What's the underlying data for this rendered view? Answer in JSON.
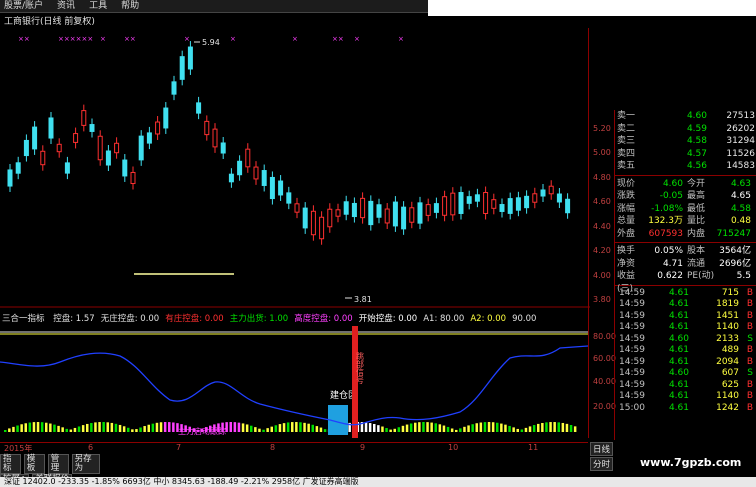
{
  "menu": [
    "股票/账户",
    "资讯",
    "工具",
    "帮助"
  ],
  "chart_title": "工商银行(日线 前复权)",
  "price_axis": [
    "5.20",
    "5.00",
    "4.80",
    "4.60",
    "4.40",
    "4.20",
    "4.00",
    "3.80"
  ],
  "annotations": {
    "high": "5.94",
    "low": "3.81"
  },
  "indicator": {
    "name": "三合一指标",
    "items": [
      {
        "label": "控盘: 1.57",
        "color": "#e0e0e0"
      },
      {
        "label": "无庄控盘: 0.00",
        "color": "#e0e0e0"
      },
      {
        "label": "有庄控盘: 0.00",
        "color": "#ff3030"
      },
      {
        "label": "主力出货: 1.00",
        "color": "#00e000"
      },
      {
        "label": "高度控盘: 0.00",
        "color": "#ff40ff"
      },
      {
        "label": "开始控盘: 0.00",
        "color": "#ffffff"
      },
      {
        "label": "A1: 80.00",
        "color": "#e0e0e0"
      },
      {
        "label": "A2: 0.00",
        "color": "#ffff40"
      },
      {
        "label": "90.00",
        "color": "#e0e0e0"
      }
    ]
  },
  "lower_axis": [
    "80.00",
    "60.00",
    "40.00",
    "20.00"
  ],
  "lower_labels": {
    "build": "建仓区",
    "sell": "跳部信号",
    "note": "主力启动跟踪"
  },
  "date_axis": [
    "2015年",
    "6",
    "7",
    "8",
    "9",
    "10",
    "11"
  ],
  "quotes": [
    {
      "label": "卖一",
      "price": "4.60",
      "vol": "27513"
    },
    {
      "label": "卖二",
      "price": "4.59",
      "vol": "26202"
    },
    {
      "label": "卖三",
      "price": "4.58",
      "vol": "31294"
    },
    {
      "label": "卖四",
      "price": "4.57",
      "vol": "11526"
    },
    {
      "label": "卖五",
      "price": "4.56",
      "vol": "14583"
    }
  ],
  "stats": [
    {
      "l1": "现价",
      "v1": "4.60",
      "l2": "今开",
      "v2": "4.63",
      "c1": "green",
      "c2": "green"
    },
    {
      "l1": "涨跌",
      "v1": "-0.05",
      "l2": "最高",
      "v2": "4.65",
      "c1": "green",
      "c2": "white"
    },
    {
      "l1": "涨幅",
      "v1": "-1.08%",
      "l2": "最低",
      "v2": "4.58",
      "c1": "green",
      "c2": "green"
    },
    {
      "l1": "总量",
      "v1": "132.3万",
      "l2": "量比",
      "v2": "0.48",
      "c1": "yellow",
      "c2": "yellow"
    },
    {
      "l1": "外盘",
      "v1": "607593",
      "l2": "内盘",
      "v2": "715247",
      "c1": "red",
      "c2": "green"
    }
  ],
  "stats2": [
    {
      "l1": "换手",
      "v1": "0.05%",
      "l2": "股本",
      "v2": "3564亿",
      "c1": "white",
      "c2": "white"
    },
    {
      "l1": "净资",
      "v1": "4.71",
      "l2": "流通",
      "v2": "2696亿",
      "c1": "white",
      "c2": "white"
    },
    {
      "l1": "收益(三)",
      "v1": "0.622",
      "l2": "PE(动)",
      "v2": "5.5",
      "c1": "white",
      "c2": "white"
    }
  ],
  "ticks": [
    {
      "time": "14:59",
      "price": "4.61",
      "vol": "715",
      "bs": "B"
    },
    {
      "time": "14:59",
      "price": "4.61",
      "vol": "1819",
      "bs": "B"
    },
    {
      "time": "14:59",
      "price": "4.61",
      "vol": "1451",
      "bs": "B"
    },
    {
      "time": "14:59",
      "price": "4.61",
      "vol": "1140",
      "bs": "B"
    },
    {
      "time": "14:59",
      "price": "4.60",
      "vol": "2133",
      "bs": "S"
    },
    {
      "time": "14:59",
      "price": "4.61",
      "vol": "489",
      "bs": "B"
    },
    {
      "time": "14:59",
      "price": "4.61",
      "vol": "2094",
      "bs": "B"
    },
    {
      "time": "14:59",
      "price": "4.60",
      "vol": "607",
      "bs": "S"
    },
    {
      "time": "14:59",
      "price": "4.61",
      "vol": "625",
      "bs": "B"
    },
    {
      "time": "14:59",
      "price": "4.61",
      "vol": "1140",
      "bs": "B"
    },
    {
      "time": "15:00",
      "price": "4.61",
      "vol": "1242",
      "bs": "B"
    }
  ],
  "tabs_row1": [
    "指标",
    "模板",
    "管理",
    "另存为"
  ],
  "tabs_row2": [
    "扩展∧",
    "关联报价"
  ],
  "right_buttons": [
    "日线",
    "分时"
  ],
  "watermark": "www.7gpzb.com",
  "status": "深证 12402.0 -233.35 -1.85% 6693亿   中小 8345.63 -188.49 -2.21% 2958亿   广发证券高端版"
}
